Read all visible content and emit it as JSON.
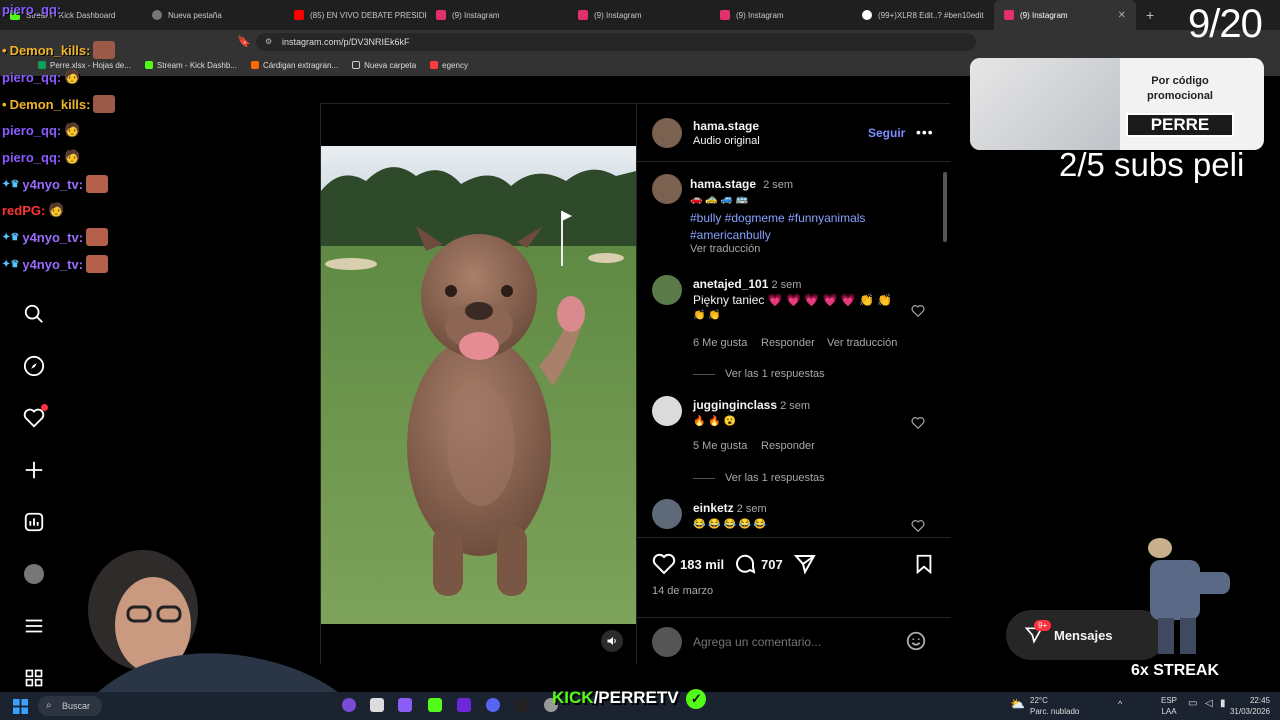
{
  "browser": {
    "tabs": [
      {
        "label": "Stream - Kick Dashboard",
        "color": "#53fc18"
      },
      {
        "label": "Nueva pestaña",
        "color": "#999999"
      },
      {
        "label": "(85) EN VIVO DEBATE PRESIDE",
        "color": "#ff0000"
      },
      {
        "label": "(9) Instagram",
        "color": "#e1306c"
      },
      {
        "label": "(9) Instagram",
        "color": "#e1306c"
      },
      {
        "label": "(9) Instagram",
        "color": "#e1306c"
      },
      {
        "label": "(99+)XLR8 Edit..? #ben10edit",
        "color": "#ffffff"
      },
      {
        "label": "(9) Instagram",
        "color": "#e1306c",
        "active": true
      }
    ],
    "url": "instagram.com/p/DV3NRIEk6kF",
    "bookmarks": [
      {
        "label": "Perre.xlsx - Hojas de...",
        "color": "#0f9d58"
      },
      {
        "label": "Stream - Kick Dashb...",
        "color": "#53fc18"
      },
      {
        "label": "Cárdigan extragran...",
        "color": "#ff6a00"
      },
      {
        "label": "Nueva carpeta",
        "color": "#cccccc"
      },
      {
        "label": "egency",
        "color": "#ff3d3d"
      }
    ]
  },
  "post": {
    "author": "hama.stage",
    "audio": "Audio original",
    "follow_label": "Seguir",
    "more_label": "•••",
    "caption": {
      "user": "hama.stage",
      "time": "2 sem",
      "emojis": "🚗 🚕 🚙 🚌",
      "tags_line1": "#bully #dogmeme #funnyanimals",
      "tags_line2": "#americanbully",
      "translate": "Ver traducción"
    },
    "comments": [
      {
        "user": "anetajed_101",
        "time": "2 sem",
        "text": "Piękny taniec 💗 💗 💗 💗 💗 👏 👏",
        "text2": "👏 👏",
        "likes": "6 Me gusta",
        "reply": "Responder",
        "translate": "Ver traducción",
        "replies": "Ver las 1 respuestas"
      },
      {
        "user": "jugginginclass",
        "time": "2 sem",
        "text": "🔥 🔥 😮",
        "likes": "5 Me gusta",
        "reply": "Responder",
        "replies": "Ver las 1 respuestas"
      },
      {
        "user": "einketz",
        "time": "2 sem",
        "text": "😂 😂 😂 😂 😂"
      }
    ],
    "likes_count": "183 mil",
    "comments_count": "707",
    "date": "14 de marzo",
    "add_comment_placeholder": "Agrega un comentario..."
  },
  "overlay": {
    "chat": [
      {
        "user": "piero_qq:",
        "color": "#8a5cff"
      },
      {
        "user": "Demon_kills:",
        "color": "#f0b429"
      },
      {
        "user": "piero_qq:",
        "color": "#8a5cff"
      },
      {
        "user": "Demon_kills:",
        "color": "#f0b429"
      },
      {
        "user": "piero_qq:",
        "color": "#8a5cff"
      },
      {
        "user": "piero_qq:",
        "color": "#8a5cff"
      },
      {
        "user": "y4nyo_tv:",
        "color": "#9b6bff"
      },
      {
        "user": "redPG:",
        "color": "#ff3333"
      },
      {
        "user": "y4nyo_tv:",
        "color": "#9b6bff"
      },
      {
        "user": "y4nyo_tv:",
        "color": "#9b6bff"
      }
    ],
    "counter": "9/20",
    "promo_title": "Por código promocional",
    "promo_code": "PERRE",
    "subs": "2/5 subs peli",
    "streak": "6x STREAK",
    "messages_label": "Mensajes",
    "messages_badge": "9+",
    "kick_logo": "KICK",
    "kick_user": "/PERRETV"
  },
  "taskbar": {
    "search": "Buscar",
    "weather_temp": "22°C",
    "weather_desc": "Parc. nublado",
    "lang1": "ESP",
    "lang2": "LAA",
    "time": "22:45",
    "date": "31/03/2026"
  }
}
